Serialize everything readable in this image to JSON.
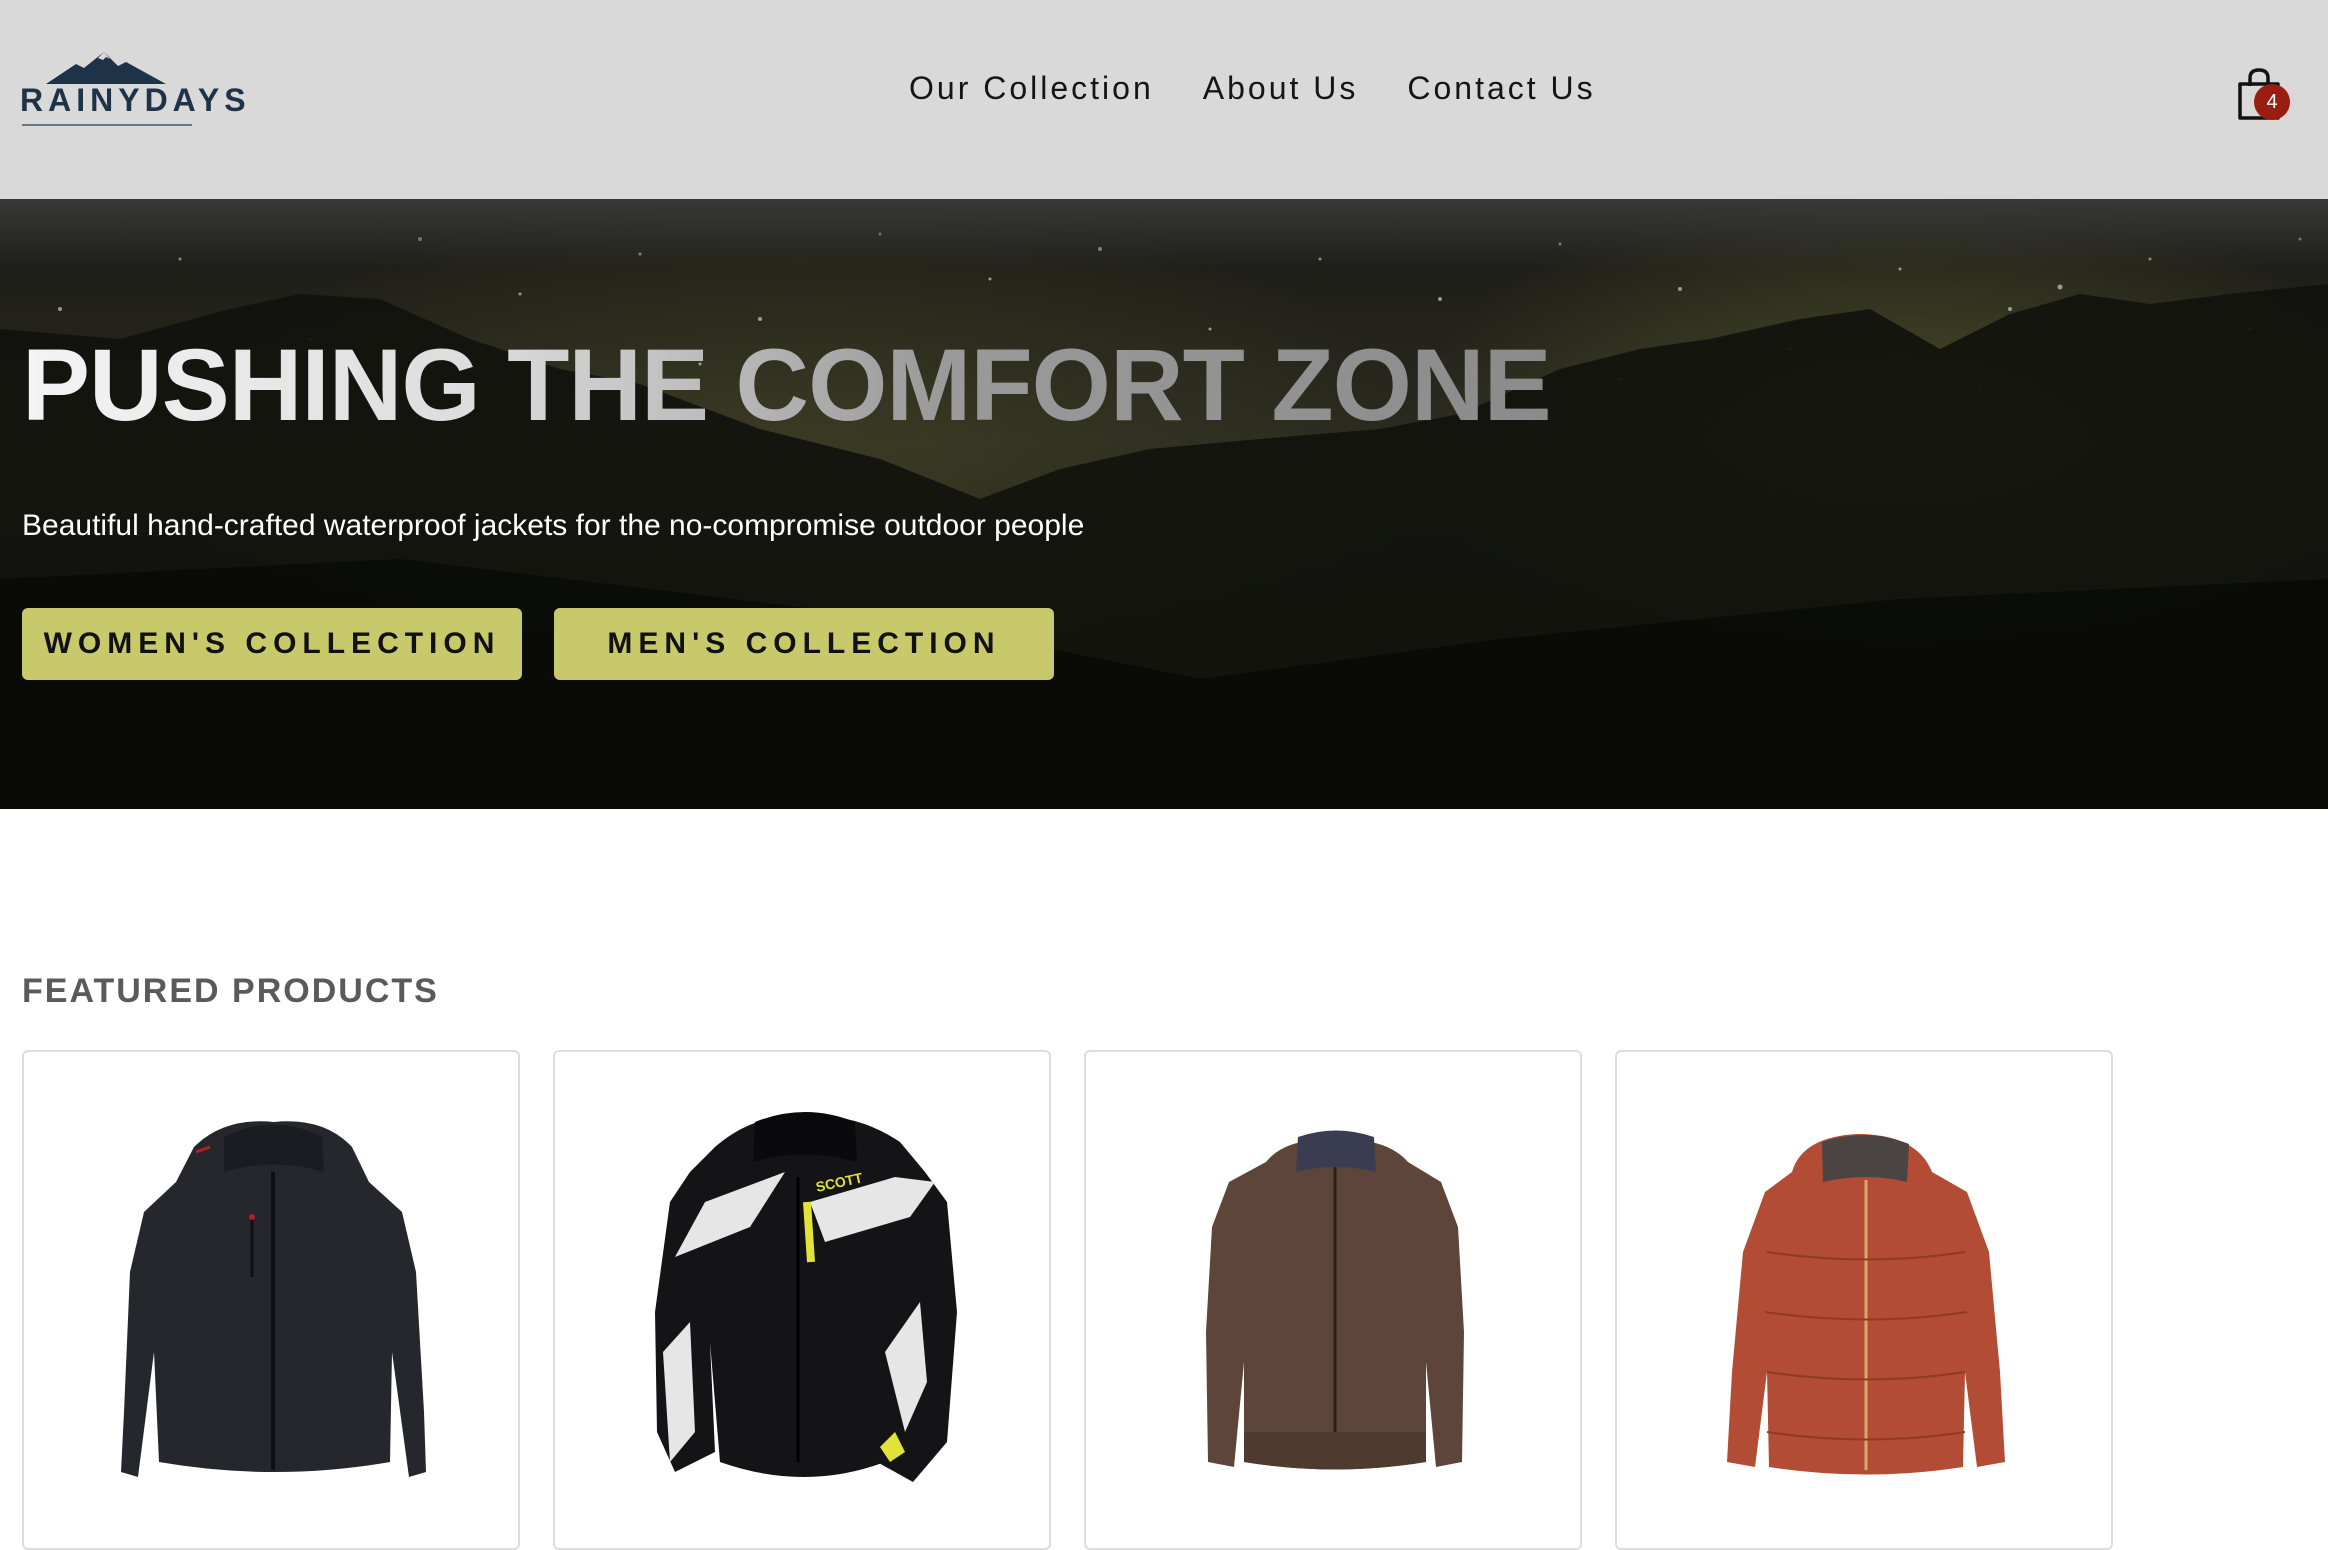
{
  "header": {
    "logo_text": "RAINYDAYS",
    "nav": [
      {
        "label": "Our Collection"
      },
      {
        "label": "About Us"
      },
      {
        "label": "Contact Us"
      }
    ],
    "cart": {
      "count": "4",
      "icon": "shopping-bag-icon"
    }
  },
  "hero": {
    "title": "PUSHING THE COMFORT ZONE",
    "subtitle": "Beautiful hand-crafted waterproof jackets for the no-compromise outdoor people",
    "buttons": {
      "women": "WOMEN'S COLLECTION",
      "men": "MEN'S COLLECTION"
    }
  },
  "featured": {
    "title": "FEATURED PRODUCTS",
    "products": [
      {
        "image": "black-hooded-jacket"
      },
      {
        "image": "black-white-scott-jacket"
      },
      {
        "image": "brown-bomber-jacket"
      },
      {
        "image": "rust-puffer-jacket"
      }
    ]
  },
  "colors": {
    "header_bg": "#d9d9d9",
    "button_bg": "#c8c96a",
    "badge_bg": "#9b1c10",
    "brand": "#1e3348"
  }
}
